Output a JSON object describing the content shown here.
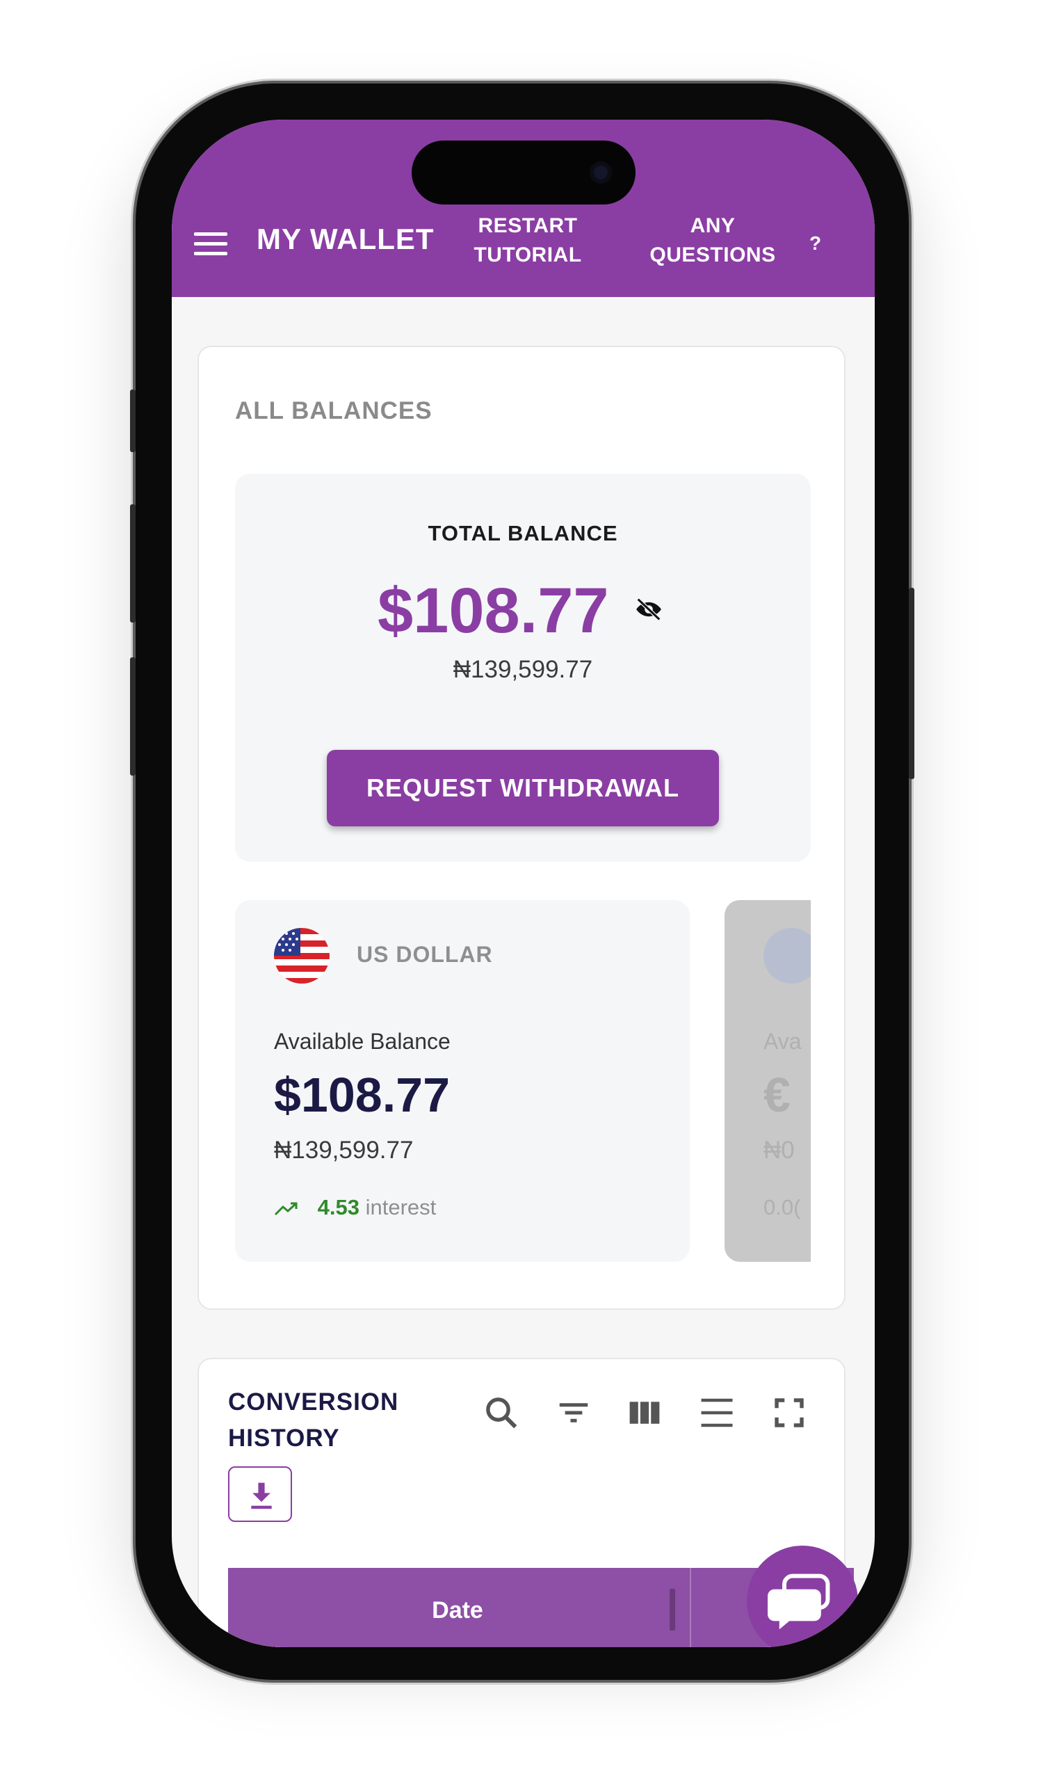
{
  "appbar": {
    "title": "MY WALLET",
    "restart_tutorial_line1": "RESTART",
    "restart_tutorial_line2": "TUTORIAL",
    "questions_line1": "ANY",
    "questions_line2": "QUESTIONS",
    "help_symbol": "?",
    "menu_icon": "hamburger-menu-icon"
  },
  "balances": {
    "section_title": "ALL BALANCES",
    "total_label": "TOTAL BALANCE",
    "total_usd": "$108.77",
    "total_naira": "₦139,599.77",
    "visibility_icon": "eye-off-icon",
    "withdraw_label": "REQUEST WITHDRAWAL"
  },
  "currency_cards": [
    {
      "name": "US DOLLAR",
      "flag_icon": "us-flag-icon",
      "available_label": "Available Balance",
      "available_value": "$108.77",
      "available_naira": "₦139,599.77",
      "interest_value": "4.53",
      "interest_label": "interest",
      "trend_icon": "trending-up-icon"
    },
    {
      "flag_icon": "eu-flag-icon",
      "available_label_partial": "Ava",
      "available_value_partial": "€",
      "available_naira_partial": "₦0",
      "interest_partial": "0.0("
    }
  ],
  "conversion_history": {
    "title_line1": "CONVERSION",
    "title_line2": "HISTORY",
    "tool_icons": [
      "search-icon",
      "filter-icon",
      "columns-icon",
      "density-icon",
      "fullscreen-icon"
    ],
    "download_icon": "download-icon",
    "columns": [
      "Date"
    ]
  },
  "chat_icon": "chat-bubble-icon",
  "colors": {
    "brand_purple": "#8a3ea3",
    "navy_text": "#1b1a45",
    "interest_green": "#2f8a2a",
    "panel_bg": "#f5f6f8"
  }
}
